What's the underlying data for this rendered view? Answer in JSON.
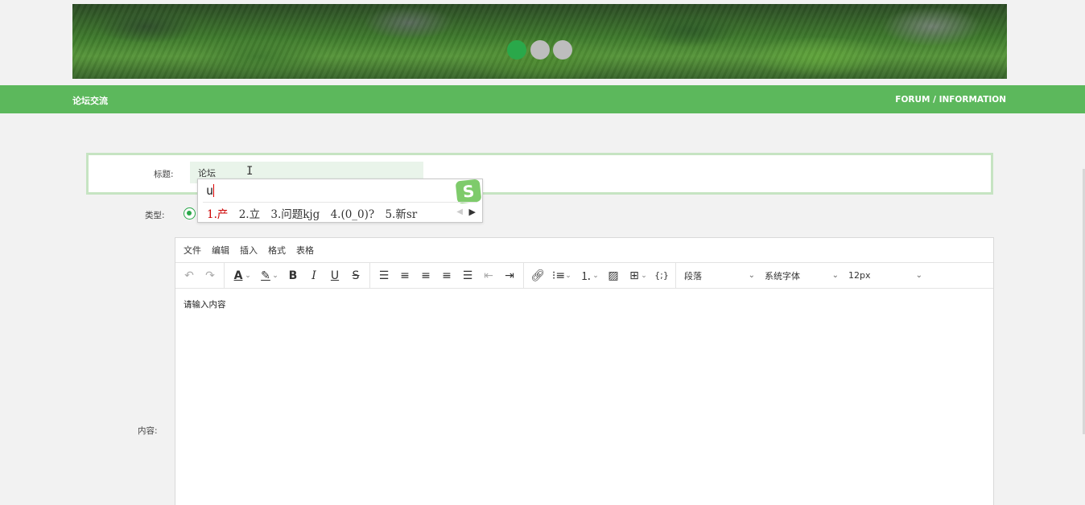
{
  "banner": {
    "dots": 3,
    "active_dot": 0,
    "accent": "#2aa84a"
  },
  "navbar": {
    "left_title": "论坛交流",
    "right_title": "FORUM / INFORMATION",
    "color": "#5cb85c"
  },
  "form": {
    "title_label": "标题:",
    "title_value": "论坛",
    "type_label": "类型:",
    "content_label": "内容:"
  },
  "ime": {
    "composition": "u",
    "candidates": [
      "1.产",
      "2.立",
      "3.问题kjg",
      "4.(0_0)?",
      "5.新sr"
    ],
    "logo": "S"
  },
  "editor": {
    "menu": [
      "文件",
      "编辑",
      "插入",
      "格式",
      "表格"
    ],
    "toolbar_icons": [
      "undo-icon",
      "redo-icon",
      "text-color-icon",
      "highlight-icon",
      "bold-icon",
      "italic-icon",
      "underline-icon",
      "strikethrough-icon",
      "line-height-icon",
      "align-left-icon",
      "align-center-icon",
      "align-right-icon",
      "align-justify-icon",
      "outdent-icon",
      "indent-icon",
      "link-icon",
      "bullet-list-icon",
      "numbered-list-icon",
      "image-icon",
      "table-icon",
      "code-icon"
    ],
    "block_format": "段落",
    "font_family": "系统字体",
    "font_size": "12px",
    "placeholder": "请输入内容"
  }
}
